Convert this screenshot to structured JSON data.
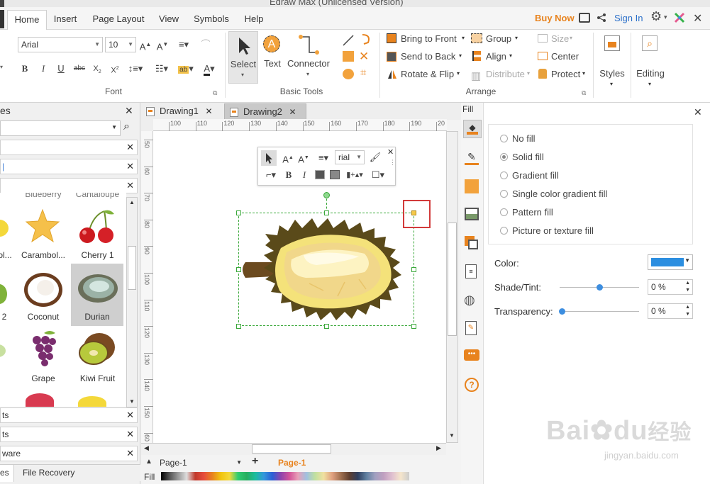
{
  "title": "Edraw Max (Unlicensed Version)",
  "menu": {
    "tabs": [
      "Home",
      "Insert",
      "Page Layout",
      "View",
      "Symbols",
      "Help"
    ],
    "buy_now": "Buy Now",
    "sign_in": "Sign In"
  },
  "ribbon": {
    "font": {
      "family": "Arial",
      "size": "10",
      "group_label": "Font"
    },
    "basic_tools": {
      "select": "Select",
      "text": "Text",
      "connector": "Connector",
      "group_label": "Basic Tools"
    },
    "arrange": {
      "bring_to_front": "Bring to Front",
      "send_to_back": "Send to Back",
      "rotate_flip": "Rotate & Flip",
      "group": "Group",
      "align": "Align",
      "distribute": "Distribute",
      "size": "Size",
      "center": "Center",
      "protect": "Protect",
      "group_label": "Arrange"
    },
    "styles": "Styles",
    "editing": "Editing"
  },
  "left_panel": {
    "title_fragment": "es",
    "row_fragments": [
      "",
      "",
      "",
      "ts",
      "ware"
    ],
    "shapes": [
      {
        "label": "Blueberry",
        "partial": true
      },
      {
        "label": "Cantaloupe",
        "partial": true
      },
      {
        "label": "Carambol..."
      },
      {
        "label": "Cherry 1"
      },
      {
        "label": "ol..."
      },
      {
        "label": "2"
      },
      {
        "label": "Coconut"
      },
      {
        "label": "Durian"
      },
      {
        "label": "Grape"
      },
      {
        "label": "Kiwi Fruit"
      }
    ],
    "bottom_tabs": [
      "es",
      "File Recovery"
    ]
  },
  "documents": {
    "tabs": [
      "Drawing1",
      "Drawing2"
    ],
    "active": 1
  },
  "ruler": {
    "h_ticks": [
      "100",
      "110",
      "120",
      "130",
      "140",
      "150",
      "160",
      "170",
      "180",
      "190",
      "20"
    ],
    "v_ticks": [
      "50",
      "60",
      "70",
      "80",
      "90",
      "100",
      "110",
      "120",
      "130",
      "140",
      "150",
      "60"
    ]
  },
  "float_toolbar": {
    "font_value": "rial"
  },
  "page_bar": {
    "page_select": "Page-1",
    "page_tab": "Page-1",
    "fill_label": "Fill"
  },
  "fill_panel": {
    "title": "Fill",
    "options": [
      "No fill",
      "Solid fill",
      "Gradient fill",
      "Single color gradient fill",
      "Pattern fill",
      "Picture or texture fill"
    ],
    "selected": 1,
    "color_label": "Color:",
    "color_value": "#2b8ee0",
    "shade_label": "Shade/Tint:",
    "shade_value": "0 %",
    "transparency_label": "Transparency:",
    "transparency_value": "0 %"
  },
  "watermark": {
    "brand": "Bai",
    "suffix": "du",
    "cn": "经验",
    "url": "jingyan.baidu.com"
  },
  "colors": {
    "accent": "#e8831e",
    "selection": "#3aa83a",
    "highlight_box": "#d23a3a"
  }
}
